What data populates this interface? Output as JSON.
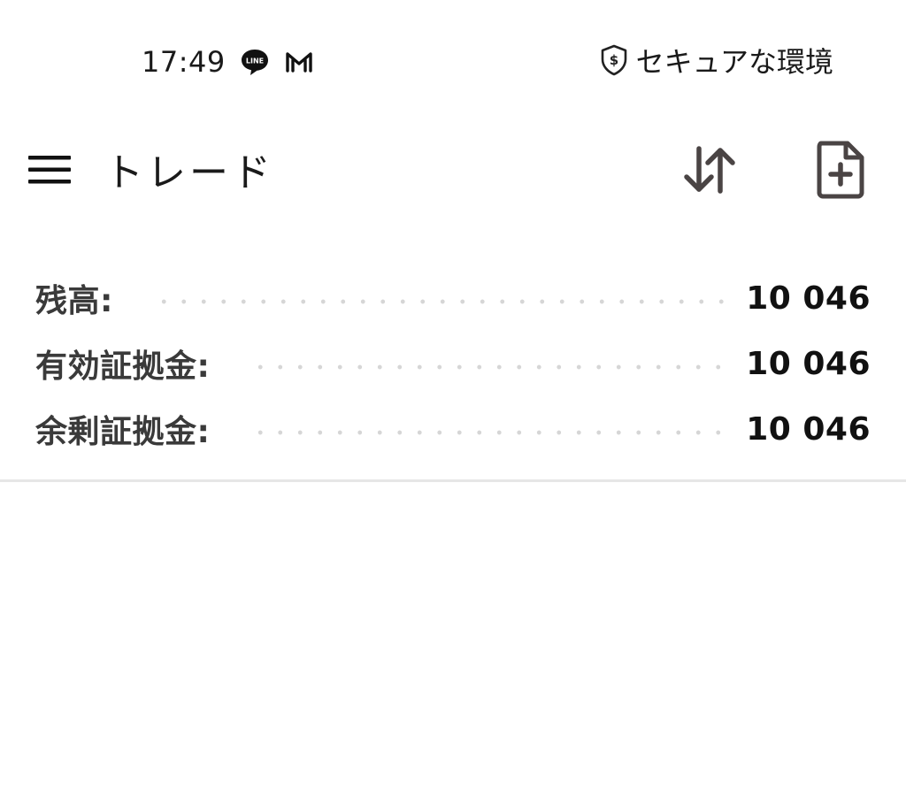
{
  "status_bar": {
    "time": "17:49",
    "notification_icons": [
      "line-icon",
      "gmail-icon"
    ],
    "secure_text": "セキュアな環境"
  },
  "app_bar": {
    "title": "トレード",
    "icon_color": "#4a4444"
  },
  "summary": [
    {
      "label": "残高:",
      "value": "10 046"
    },
    {
      "label": "有効証拠金:",
      "value": "10 046"
    },
    {
      "label": "余剰証拠金:",
      "value": "10 046"
    }
  ]
}
